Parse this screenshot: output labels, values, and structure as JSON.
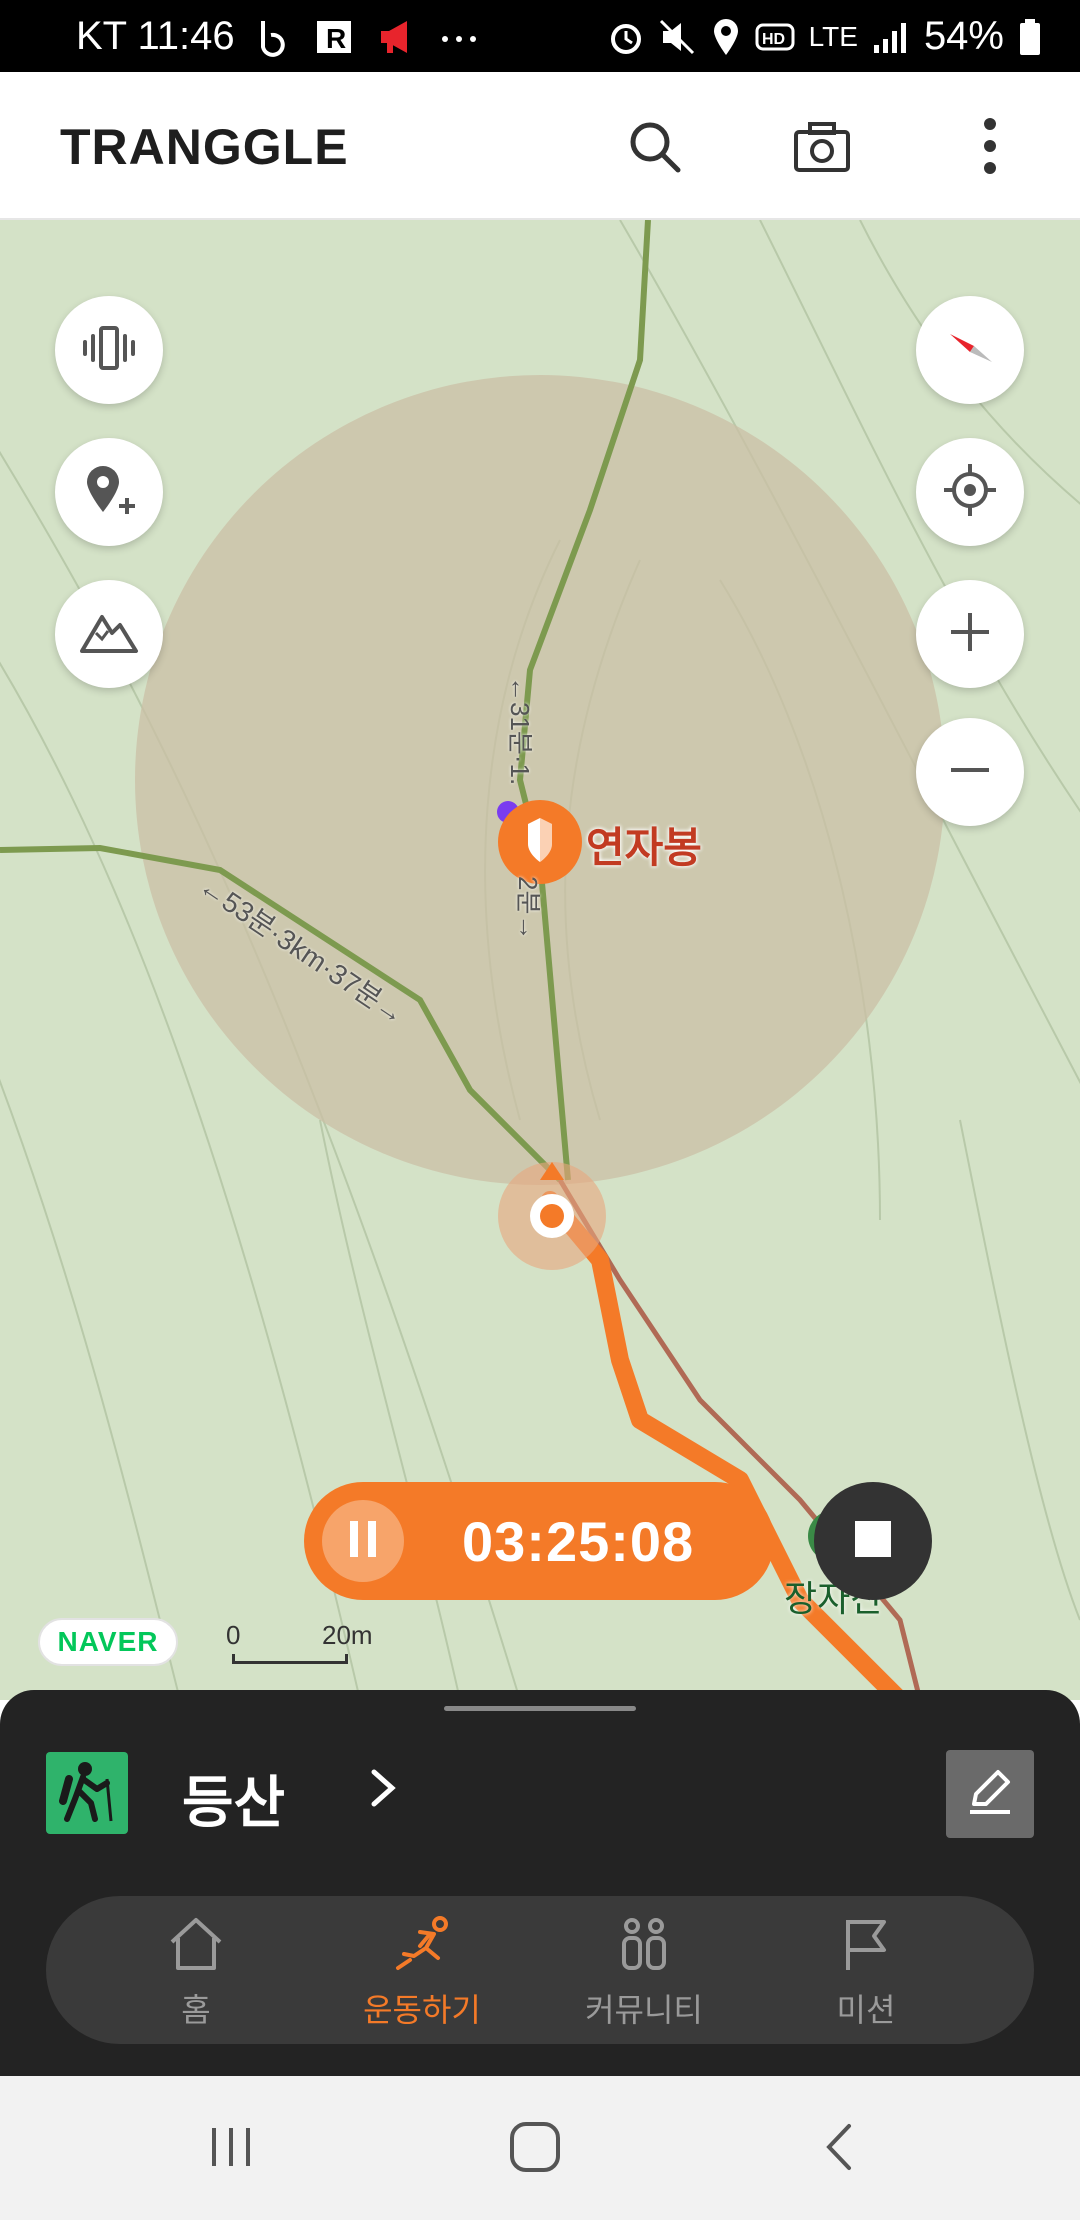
{
  "statusbar": {
    "carrier_time": "KT 11:46",
    "network": "LTE",
    "battery": "54%",
    "icons": [
      "b-app-icon",
      "r-app-icon",
      "megaphone-icon",
      "more-dots-icon",
      "alarm-icon",
      "mute-icon",
      "location-icon",
      "hd-icon",
      "signal-icon",
      "battery-icon"
    ]
  },
  "header": {
    "logo": "TRANGGLE",
    "icons": [
      "search-icon",
      "camera-icon",
      "more-vertical-icon"
    ]
  },
  "map": {
    "peak_name": "연자봉",
    "peak_name_2": "장자산",
    "trail_label_1": "←53분·3km·37분→",
    "trail_label_2": "←31분·1.",
    "trail_label_3": "2분→",
    "left_controls": [
      "vibration-icon",
      "add-location-icon",
      "mountain-icon"
    ],
    "right_controls": [
      "compass-icon",
      "my-location-icon",
      "zoom-in-icon",
      "zoom-out-icon"
    ],
    "attribution": "NAVER",
    "scale": {
      "start": "0",
      "end": "20m"
    }
  },
  "recording": {
    "timer": "03:25:08",
    "colors": {
      "accent": "#f47a28",
      "dark": "#333333"
    }
  },
  "activity": {
    "title": "등산",
    "icons": [
      "hiking-icon",
      "chevron-right-icon",
      "edit-icon"
    ]
  },
  "tabs": [
    {
      "label": "홈",
      "icon": "home-icon",
      "active": false
    },
    {
      "label": "운동하기",
      "icon": "running-icon",
      "active": true
    },
    {
      "label": "커뮤니티",
      "icon": "community-icon",
      "active": false
    },
    {
      "label": "미션",
      "icon": "flag-icon",
      "active": false
    }
  ],
  "system_nav": [
    "recent-apps-icon",
    "home-circle-icon",
    "back-icon"
  ]
}
